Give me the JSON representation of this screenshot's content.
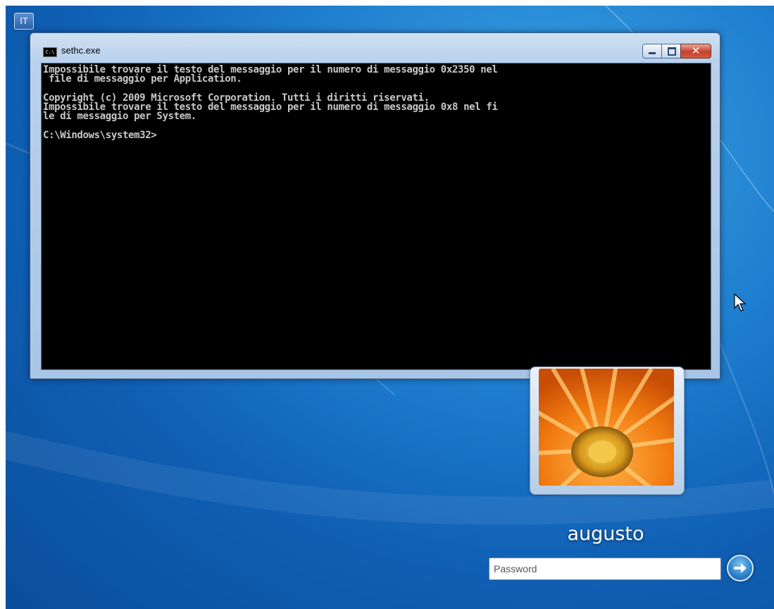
{
  "desktop": {
    "language_indicator": "IT"
  },
  "console_window": {
    "title": "sethc.exe",
    "icon": "command-prompt-icon",
    "lines": [
      "Impossibile trovare il testo del messaggio per il numero di messaggio 0x2350 nel",
      " file di messaggio per Application.",
      "",
      "Copyright (c) 2009 Microsoft Corporation. Tutti i diritti riservati.",
      "Impossibile trovare il testo del messaggio per il numero di messaggio 0x8 nel fi",
      "le di messaggio per System.",
      "",
      "C:\\Windows\\system32>"
    ],
    "colors": {
      "background": "#000000",
      "text": "#c8c8c8"
    }
  },
  "logon": {
    "username": "augusto",
    "password_placeholder": "Password",
    "password_value": ""
  }
}
